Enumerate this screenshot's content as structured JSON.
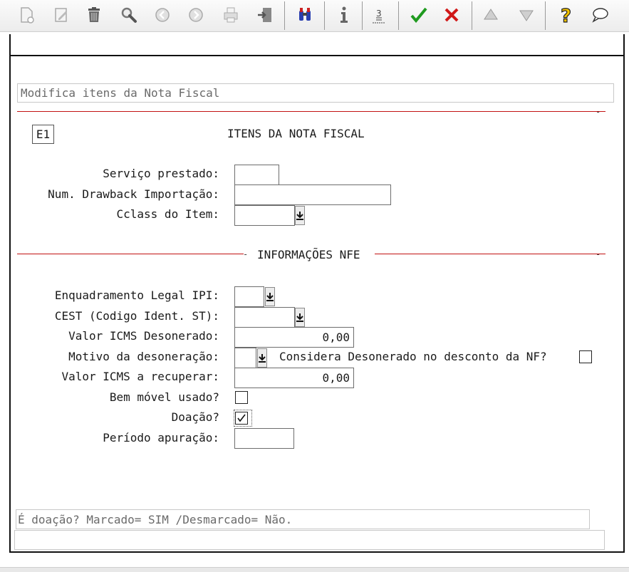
{
  "form": {
    "title_hint": "Modifica itens da Nota Fiscal",
    "code": "E1",
    "heading": "ITENS DA NOTA FISCAL",
    "section_nfe": "INFORMAÇÕES NFE",
    "fields": {
      "servico_prestado": {
        "label": "Serviço prestado:",
        "value": ""
      },
      "num_drawback": {
        "label": "Num. Drawback Importação:",
        "value": ""
      },
      "cclass_item": {
        "label": "Cclass do Item:",
        "value": ""
      },
      "enquadramento_ipi": {
        "label": "Enquadramento Legal IPI:",
        "value": ""
      },
      "cest": {
        "label": "CEST (Codigo Ident. ST):",
        "value": ""
      },
      "valor_icms_desonerado": {
        "label": "Valor ICMS Desonerado:",
        "value": "0,00"
      },
      "motivo_desoneracao": {
        "label": "Motivo da desoneração:",
        "value": ""
      },
      "considera_desonerado": {
        "label": "Considera Desonerado no desconto da NF?",
        "checked": false
      },
      "valor_icms_recuperar": {
        "label": "Valor ICMS a recuperar:",
        "value": "0,00"
      },
      "bem_movel_usado": {
        "label": "Bem móvel usado?",
        "checked": false
      },
      "doacao": {
        "label": "Doação?",
        "checked": true
      },
      "periodo_apuracao": {
        "label": "Período apuração:",
        "value": ""
      }
    },
    "help_text": "É doação? Marcado= SIM /Desmarcado= Não.",
    "status_text": ""
  },
  "toolbar": {
    "icons": [
      "new-doc-icon",
      "edit-icon",
      "trash-icon",
      "search-icon",
      "prev-icon",
      "next-icon",
      "print-icon",
      "exit-icon",
      "binoculars-icon",
      "info-icon",
      "numbered-list-icon",
      "confirm-icon",
      "cancel-icon",
      "up-icon",
      "down-icon",
      "help-icon",
      "comment-icon"
    ]
  },
  "colors": {
    "accent_line": "#c21212",
    "confirm": "#1f9a1f",
    "cancel": "#d01818",
    "help": "#f2c200"
  }
}
